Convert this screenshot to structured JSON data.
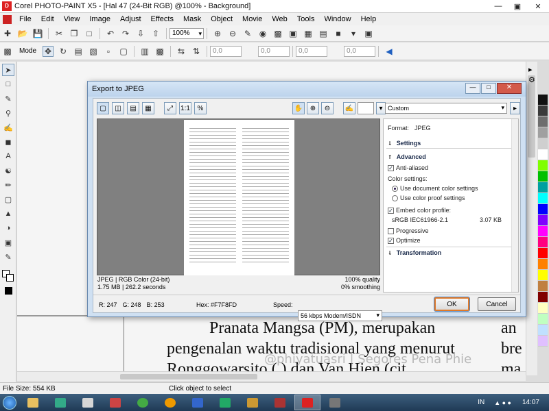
{
  "window": {
    "title": "Corel PHOTO-PAINT X5 - [Hal 47 (24-Bit RGB) @100% - Background]"
  },
  "menu": [
    "File",
    "Edit",
    "View",
    "Image",
    "Adjust",
    "Effects",
    "Mask",
    "Object",
    "Movie",
    "Web",
    "Tools",
    "Window",
    "Help"
  ],
  "toolbar": {
    "zoom": "100%"
  },
  "propbar": {
    "mode_label": "Mode",
    "x_val": "0,0",
    "y_val": "0,0",
    "w_val": "0,0",
    "h_val": "0,0"
  },
  "dialog": {
    "title": "Export to JPEG",
    "preset": "Custom",
    "info": {
      "format_line": "JPEG  |  RGB Color (24-bit)",
      "size_line": "1.75 MB  |  262.2 seconds",
      "quality": "100% quality",
      "smoothing": "0% smoothing"
    },
    "pixel": {
      "r": "R: 247",
      "g": "G: 248",
      "b": "B: 253",
      "hex": "Hex: #F7F8FD"
    },
    "speed_label": "Speed:",
    "speed_value": "56 kbps Modem/ISDN",
    "ok": "OK",
    "cancel": "Cancel",
    "settings": {
      "format_label": "Format:",
      "format_value": "JPEG",
      "section_settings": "Settings",
      "section_advanced": "Advanced",
      "anti_aliased": "Anti-aliased",
      "color_settings": "Color settings:",
      "use_document": "Use document color settings",
      "use_proof": "Use color proof settings",
      "embed_profile": "Embed color profile:",
      "profile_name": "sRGB IEC61966-2.1",
      "profile_size": "3.07 KB",
      "progressive": "Progressive",
      "optimize": "Optimize",
      "section_transformation": "Transformation"
    }
  },
  "document_text": {
    "line1a": "Pranata  Mangsa  (PM),  merupakan",
    "line1b": "an",
    "line2a": "pengenalan waktu tradisional yang menurut",
    "line2b": "bre",
    "line3": "Ronggowarsito (   )  dan Van Hien (cit",
    "line3b": "ma",
    "watermark": "@phiyatuasri | Segores Pena Phie"
  },
  "status": {
    "file_size": "File Size: 554 KB",
    "hint": "Click object to select"
  },
  "taskbar": {
    "lang": "IN",
    "time": "14:07"
  },
  "palette": [
    "#111111",
    "#3a3a3a",
    "#6e6e6e",
    "#a0a0a0",
    "#cfcfcf",
    "#ffffff",
    "#7fff00",
    "#00c000",
    "#00a0a0",
    "#00ffff",
    "#0000ff",
    "#8000ff",
    "#ff00ff",
    "#ff0080",
    "#ff0000",
    "#ff8000",
    "#ffff00",
    "#c08040",
    "#800000",
    "#ffffc0",
    "#c0ffc0",
    "#c0e0ff",
    "#e0c0ff"
  ]
}
